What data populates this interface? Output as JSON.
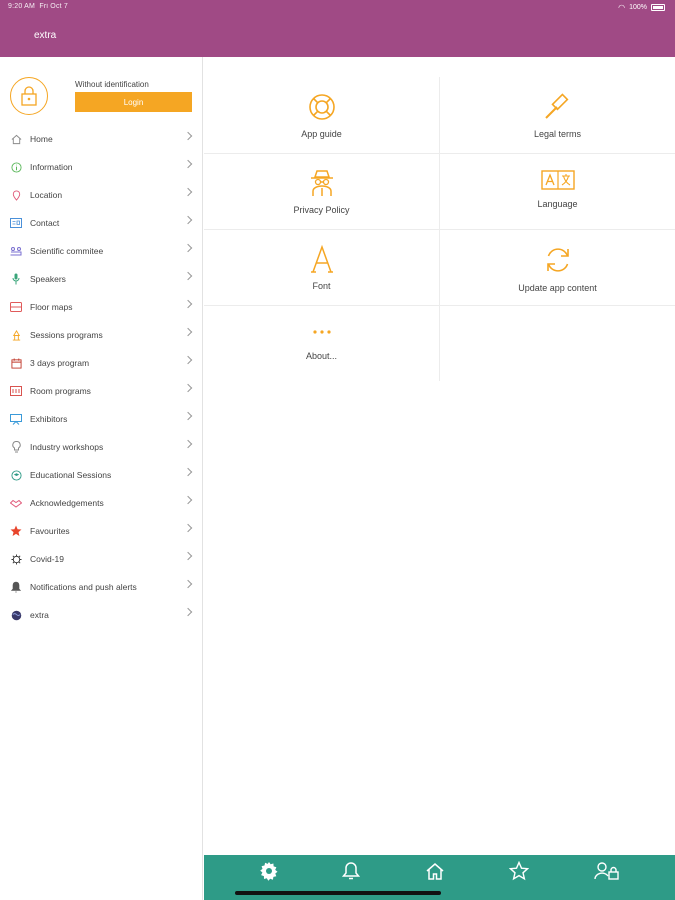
{
  "status": {
    "time": "9:20 AM",
    "date": "Fri Oct 7",
    "battery": "100%"
  },
  "header": {
    "title": "extra"
  },
  "profile": {
    "status_text": "Without identification",
    "login_label": "Login"
  },
  "menu": [
    {
      "label": "Home",
      "icon": "home-icon",
      "color": "#8a8a8a"
    },
    {
      "label": "Information",
      "icon": "info-icon",
      "color": "#5cb85c"
    },
    {
      "label": "Location",
      "icon": "location-pin-icon",
      "color": "#e05a7a"
    },
    {
      "label": "Contact",
      "icon": "contact-card-icon",
      "color": "#4a90d9"
    },
    {
      "label": "Scientific commitee",
      "icon": "committee-icon",
      "color": "#7a6fd0"
    },
    {
      "label": "Speakers",
      "icon": "microphone-icon",
      "color": "#3aa57a"
    },
    {
      "label": "Floor maps",
      "icon": "floor-map-icon",
      "color": "#e05a5a"
    },
    {
      "label": "Sessions programs",
      "icon": "sessions-icon",
      "color": "#f5a623"
    },
    {
      "label": "3 days program",
      "icon": "calendar-icon",
      "color": "#c0392b"
    },
    {
      "label": "Room programs",
      "icon": "room-icon",
      "color": "#d9534f"
    },
    {
      "label": "Exhibitors",
      "icon": "exhibitors-icon",
      "color": "#3a9ad9"
    },
    {
      "label": "Industry workshops",
      "icon": "lightbulb-icon",
      "color": "#8a8a8a"
    },
    {
      "label": "Educational Sessions",
      "icon": "education-icon",
      "color": "#2e9b87"
    },
    {
      "label": "Acknowledgements",
      "icon": "handshake-icon",
      "color": "#e05a7a"
    },
    {
      "label": "Favourites",
      "icon": "star-icon",
      "color": "#e8452c"
    },
    {
      "label": "Covid-19",
      "icon": "virus-icon",
      "color": "#333333"
    },
    {
      "label": "Notifications and push alerts",
      "icon": "bell-icon",
      "color": "#555555"
    },
    {
      "label": "extra",
      "icon": "globe-icon",
      "color": "#3a3a6a"
    }
  ],
  "tiles": [
    {
      "label": "App guide",
      "icon": "lifebuoy-icon"
    },
    {
      "label": "Legal terms",
      "icon": "gavel-icon"
    },
    {
      "label": "Privacy Policy",
      "icon": "spy-icon"
    },
    {
      "label": "Language",
      "icon": "language-icon"
    },
    {
      "label": "Font",
      "icon": "font-icon"
    },
    {
      "label": "Update app content",
      "icon": "refresh-icon"
    },
    {
      "label": "About...",
      "icon": "more-dots-icon"
    }
  ],
  "colors": {
    "accent": "#f5a623",
    "header": "#a04a85",
    "tabbar": "#2e9b87"
  },
  "tabbar": [
    "settings-icon",
    "bell-icon",
    "home-icon",
    "star-icon",
    "user-lock-icon"
  ]
}
